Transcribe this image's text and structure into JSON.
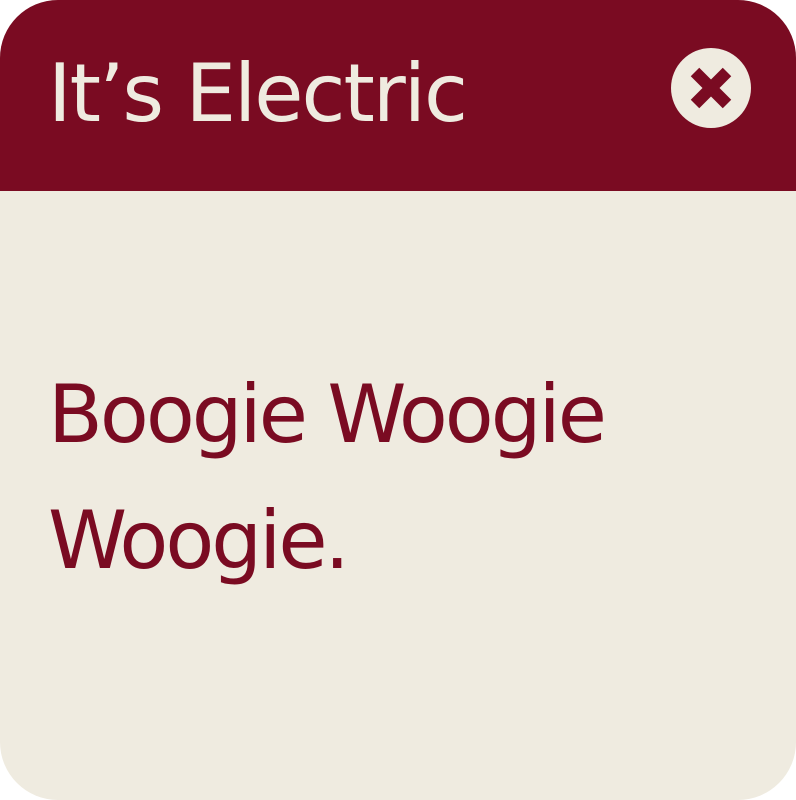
{
  "dialog": {
    "title": "It’s Electric",
    "message": "Boogie Woogie Woogie.",
    "close_icon": "close-icon"
  },
  "colors": {
    "header_bg": "#7a0b22",
    "body_bg": "#efebe0",
    "title_text": "#efebe0",
    "message_text": "#7a0b22"
  }
}
